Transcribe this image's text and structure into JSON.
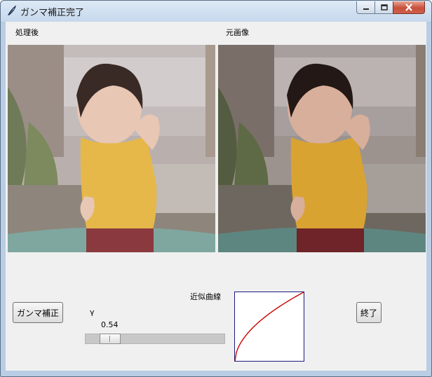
{
  "window": {
    "title": "ガンマ補正完了"
  },
  "labels": {
    "processed": "処理後",
    "original": "元画像",
    "curve": "近似曲線",
    "gamma_symbol": "γ"
  },
  "controls": {
    "gamma_button": "ガンマ補正",
    "exit_button": "終了"
  },
  "slider": {
    "value_text": "0.54",
    "value": 0.54
  },
  "colors": {
    "curve": "#cc0000",
    "curve_frame": "#1a1a80"
  }
}
